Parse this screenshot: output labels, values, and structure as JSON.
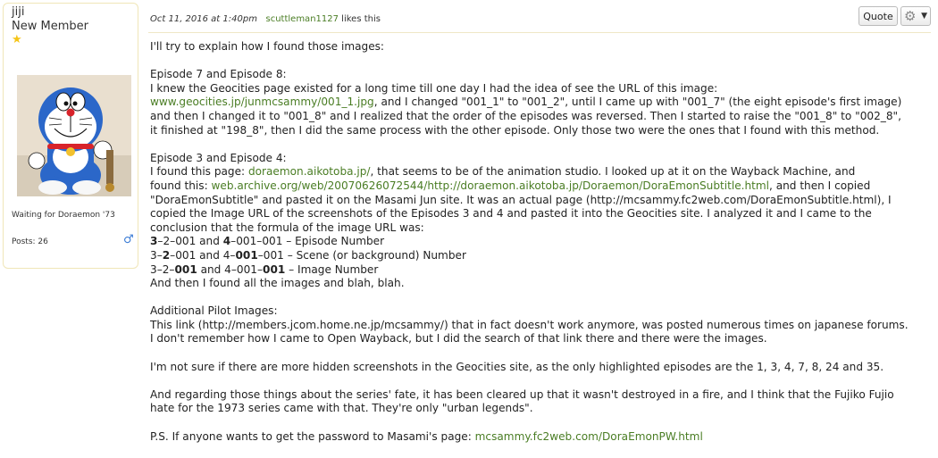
{
  "user": {
    "name": "jiji",
    "title": "New Member",
    "status_text": "Waiting for Doraemon '73",
    "posts": "Posts: 26"
  },
  "post": {
    "date": "Oct 11, 2016 at 1:40pm",
    "liker": "scuttleman1127",
    "likes_text": "likes this",
    "quote_label": "Quote",
    "paragraphs": {
      "intro": "I'll try to explain how I found those images:",
      "ep78_title": "Episode 7 and Episode 8:",
      "ep78_l1": "I knew the Geocities page existed for a long time till one day I had the idea of see the URL of this image:",
      "ep78_link": "www.geocities.jp/junmcsammy/001_1.jpg",
      "ep78_l2_rest": ", and I changed \"001_1\" to \"001_2\", until I came up with \"001_7\" (the eight episode's first image)",
      "ep78_l3": "and then I changed it to \"001_8\" and I realized that the order of the episodes was reversed. Then I started to raise the \"001_8\" to \"002_8\",",
      "ep78_l4": "it finished at \"198_8\", then I did the same process with the other episode. Only those two were the ones that I found with this method.",
      "ep34_title": "Episode 3 and Episode 4:",
      "ep34_l1_pre": "I found this page: ",
      "ep34_link1": "doraemon.aikotoba.jp/",
      "ep34_l1_post": ", that seems to be of the animation studio. I looked up at it on the Wayback Machine, and",
      "ep34_l2_pre": "found this: ",
      "ep34_link2": "web.archive.org/web/20070626072544/http://doraemon.aikotoba.jp/Doraemon/DoraEmonSubtitle.html",
      "ep34_l2_post": ", and then I copied",
      "ep34_l3": "\"DoraEmonSubtitle\" and pasted it on the Masami Jun site. It was an actual page (http://mcsammy.fc2web.com/DoraEmonSubtitle.html), I",
      "ep34_l4": "copied the Image URL of the screenshots of the Episodes 3 and 4 and pasted it into the Geocities site. I analyzed it and I came to the",
      "ep34_l5": "conclusion that the formula of the image URL was:",
      "f1_a": "3",
      "f1_b": "–2–001 and ",
      "f1_c": "4",
      "f1_d": "–001–001 – Episode Number",
      "f2_a": "3–",
      "f2_b": "2",
      "f2_c": "–001 and 4–",
      "f2_d": "001",
      "f2_e": "–001 – Scene (or background) Number",
      "f3_a": "3–2–",
      "f3_b": "001",
      "f3_c": " and 4–001–",
      "f3_d": "001",
      "f3_e": " – Image Number",
      "ep34_end": "And then I found all the images and blah, blah.",
      "pilot_title": "Additional Pilot Images:",
      "pilot_l1": "This link (http://members.jcom.home.ne.jp/mcsammy/) that in fact doesn't work anymore, was posted numerous times on japanese forums.",
      "pilot_l2": "I don't remember how I came to Open Wayback, but I did the search of that link there and there were the images.",
      "hidden": "I'm not sure if there are more hidden screenshots in the Geocities site, as the only highlighted episodes are the 1, 3, 4, 7, 8, 24 and 35.",
      "fate_l1": "And regarding those things about the series' fate, it has been cleared up that it wasn't destroyed in a fire, and I think that the Fujiko Fujio",
      "fate_l2": "hate for the 1973 series came with that. They're only \"urban legends\".",
      "ps_pre": "P.S. If anyone wants to get the password to Masami's page: ",
      "ps_link": "mcsammy.fc2web.com/DoraEmonPW.html"
    }
  },
  "colors": {
    "link": "#4a7d24",
    "border": "#f0e6b8",
    "male": "#3a7bd5"
  },
  "icons": [
    "star-icon",
    "male-icon",
    "gear-icon",
    "caret-down-icon"
  ]
}
